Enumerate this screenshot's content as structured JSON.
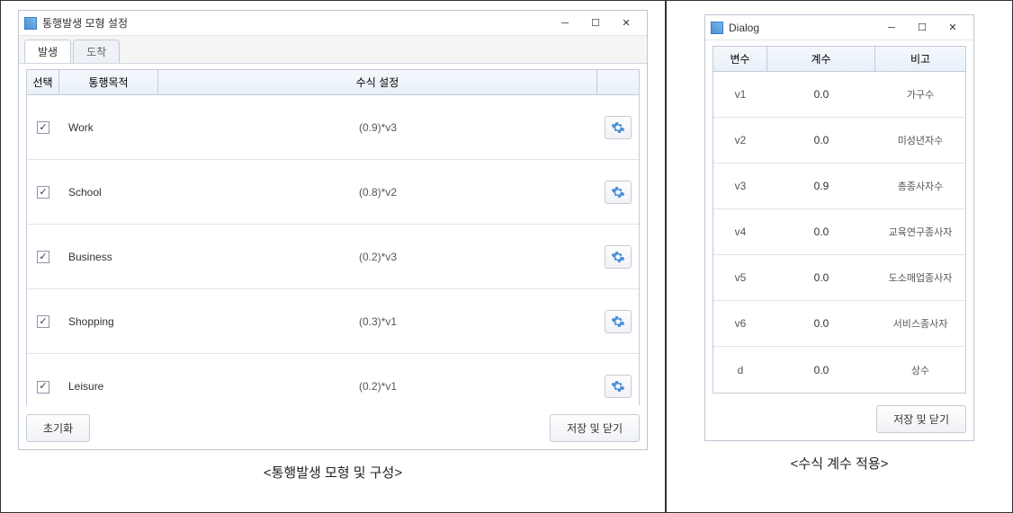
{
  "left": {
    "window_title": "통행발생 모형 설정",
    "tabs": [
      {
        "label": "발생",
        "active": true
      },
      {
        "label": "도착",
        "active": false
      }
    ],
    "columns": {
      "select": "선택",
      "purpose": "통행목적",
      "formula": "수식 설정"
    },
    "rows": [
      {
        "checked": true,
        "purpose": "Work",
        "formula": "(0.9)*v3"
      },
      {
        "checked": true,
        "purpose": "School",
        "formula": "(0.8)*v2"
      },
      {
        "checked": true,
        "purpose": "Business",
        "formula": "(0.2)*v3"
      },
      {
        "checked": true,
        "purpose": "Shopping",
        "formula": "(0.3)*v1"
      },
      {
        "checked": true,
        "purpose": "Leisure",
        "formula": "(0.2)*v1"
      }
    ],
    "buttons": {
      "reset": "초기화",
      "save_close": "저장 및 닫기"
    },
    "caption": "<통행발생 모형 및 구성>"
  },
  "right": {
    "window_title": "Dialog",
    "columns": {
      "variable": "변수",
      "coefficient": "계수",
      "note": "비고"
    },
    "rows": [
      {
        "var": "v1",
        "coef": "0.0",
        "note": "가구수"
      },
      {
        "var": "v2",
        "coef": "0.0",
        "note": "미성년자수"
      },
      {
        "var": "v3",
        "coef": "0.9",
        "note": "총종사자수"
      },
      {
        "var": "v4",
        "coef": "0.0",
        "note": "교육연구종사자"
      },
      {
        "var": "v5",
        "coef": "0.0",
        "note": "도소매업종사자"
      },
      {
        "var": "v6",
        "coef": "0.0",
        "note": "서비스종사자"
      },
      {
        "var": "d",
        "coef": "0.0",
        "note": "상수"
      }
    ],
    "buttons": {
      "save_close": "저장 및 닫기"
    },
    "caption": "<수식 계수 적용>"
  },
  "icons": {
    "gear": "gear-icon",
    "minimize": "─",
    "maximize": "☐",
    "close": "✕"
  }
}
